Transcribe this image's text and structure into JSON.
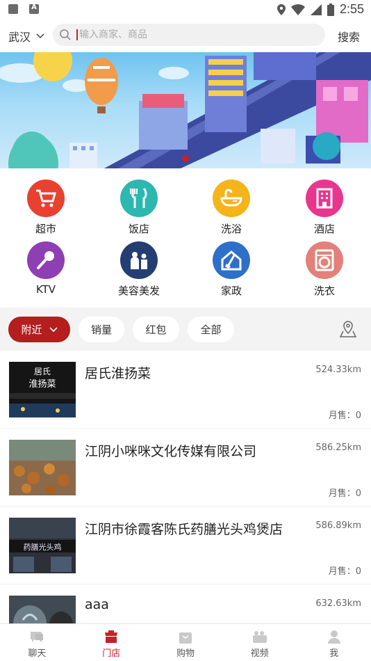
{
  "status_bar": {
    "time": "2:55"
  },
  "header": {
    "city": "武汉",
    "search_placeholder": "输入商家、商品",
    "search_button": "搜索"
  },
  "categories": [
    {
      "label": "超市",
      "icon": "shopping-cart-icon",
      "color": "#e8412f"
    },
    {
      "label": "饭店",
      "icon": "fork-knife-icon",
      "color": "#2cb8b0"
    },
    {
      "label": "洗浴",
      "icon": "bathtub-icon",
      "color": "#f4b41a"
    },
    {
      "label": "酒店",
      "icon": "hotel-building-icon",
      "color": "#e8368f"
    },
    {
      "label": "KTV",
      "icon": "microphone-icon",
      "color": "#8e3fb3"
    },
    {
      "label": "美容美发",
      "icon": "barber-icon",
      "color": "#243d73"
    },
    {
      "label": "家政",
      "icon": "house-broom-icon",
      "color": "#2e6fc9"
    },
    {
      "label": "洗衣",
      "icon": "washing-machine-icon",
      "color": "#e4807a"
    }
  ],
  "filters": {
    "active": "附近",
    "items": [
      "销量",
      "红包",
      "全部"
    ]
  },
  "stores": [
    {
      "name": "居氏淮扬菜",
      "distance": "524.33km",
      "sales": "月售：0",
      "thumb_text": "居氏 淮扬菜"
    },
    {
      "name": "江阴小咪咪文化传媒有限公司",
      "distance": "586.25km",
      "sales": "月售：0",
      "thumb_text": ""
    },
    {
      "name": "江阴市徐霞客陈氏药膳光头鸡煲店",
      "distance": "586.89km",
      "sales": "月售：0",
      "thumb_text": "药膳光头鸡"
    },
    {
      "name": "aaa",
      "distance": "632.63km",
      "sales": "",
      "thumb_text": ""
    }
  ],
  "bottom_nav": [
    {
      "label": "聊天",
      "icon": "chat-icon"
    },
    {
      "label": "门店",
      "icon": "store-icon",
      "active": true
    },
    {
      "label": "购物",
      "icon": "shopping-bag-icon"
    },
    {
      "label": "视频",
      "icon": "video-icon"
    },
    {
      "label": "我",
      "icon": "user-icon"
    }
  ],
  "colors": {
    "accent": "#c8202a",
    "filter_active": "#b51e1e"
  }
}
